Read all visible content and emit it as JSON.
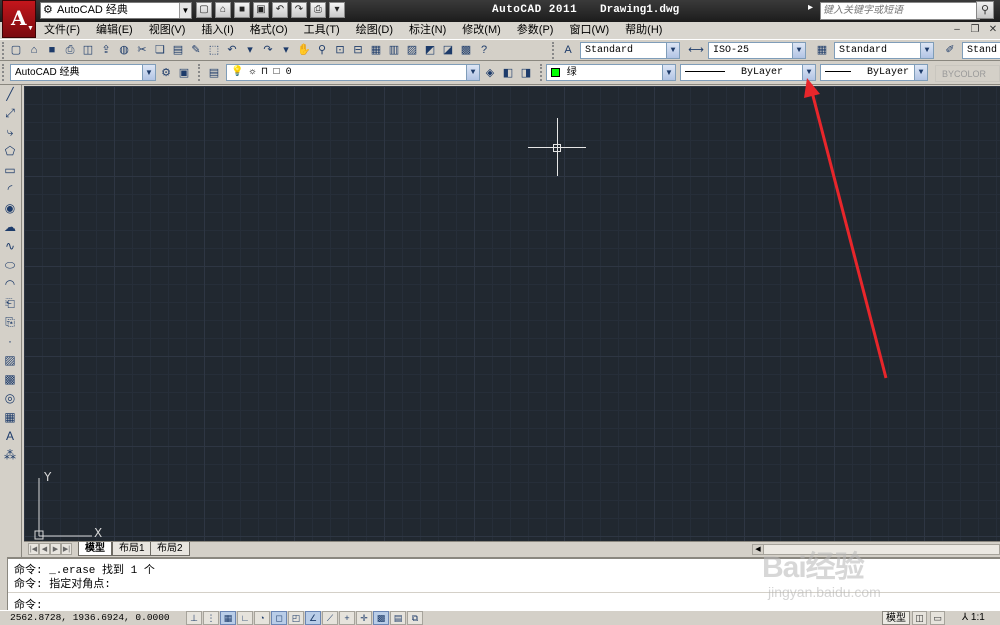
{
  "title_bar": {
    "app_name": "AutoCAD 2011",
    "file_name": "Drawing1.dwg",
    "workspace": "AutoCAD 经典",
    "search_placeholder": "键入关键字或短语"
  },
  "menu": {
    "items": [
      "文件(F)",
      "编辑(E)",
      "视图(V)",
      "插入(I)",
      "格式(O)",
      "工具(T)",
      "绘图(D)",
      "标注(N)",
      "修改(M)",
      "参数(P)",
      "窗口(W)",
      "帮助(H)"
    ]
  },
  "styles_toolbar": {
    "text_style": "Standard",
    "dim_style": "ISO-25",
    "table_style": "Standard",
    "multileader_style": "Stand"
  },
  "workspace_toolbar": {
    "workspace": "AutoCAD 经典",
    "layer": "0",
    "color": "绿",
    "linetype": "ByLayer",
    "lineweight": "ByLayer",
    "plot_style": "BYCOLOR"
  },
  "ucs": {
    "x_label": "X",
    "y_label": "Y"
  },
  "layout_tabs": [
    "模型",
    "布局1",
    "布局2"
  ],
  "command_window": {
    "lines": [
      "命令: _.erase 找到 1 个",
      "命令: 指定对角点:"
    ],
    "prompt": "命令:"
  },
  "status_bar": {
    "coordinates": "2562.8728, 1936.6924, 0.0000",
    "model_label": "模型",
    "annotation_scale": "1:1"
  },
  "watermark": {
    "brand": "Bai经验",
    "url": "jingyan.baidu.com"
  },
  "colors": {
    "canvas_bg": "#212830",
    "layer_color": "#00ff00",
    "annotation_arrow": "#e8262b",
    "title_bar": "#1c1c1c"
  }
}
